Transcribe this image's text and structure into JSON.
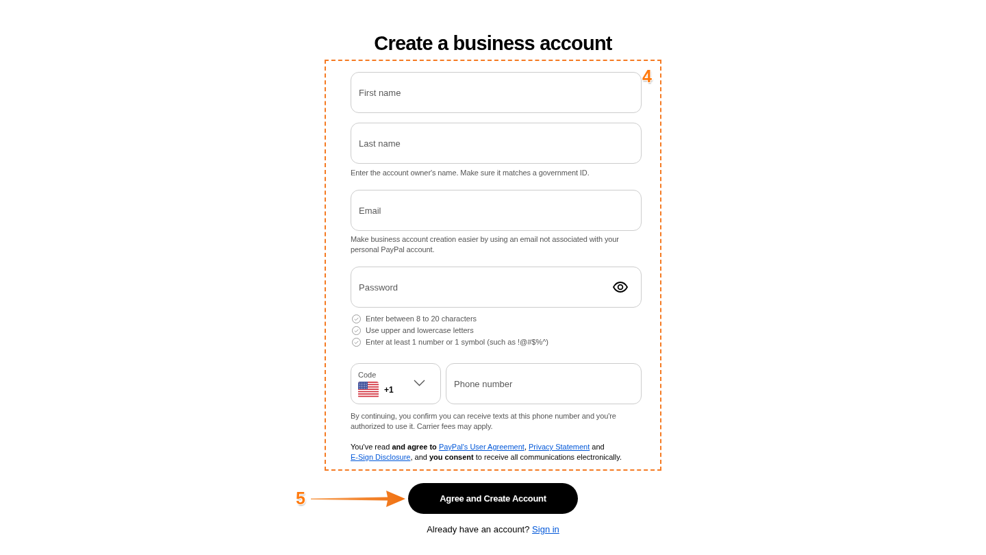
{
  "title": "Create a business account",
  "form": {
    "step_label": "4",
    "fields": [
      {
        "kind": "text",
        "placeholder": "First name"
      },
      {
        "kind": "text",
        "placeholder": "Last name",
        "hint": "Enter the account owner's name. Make sure it matches a government ID."
      },
      {
        "kind": "text",
        "placeholder": "Email",
        "hint": "Make business account creation easier by using an email not associated with your personal PayPal account."
      },
      {
        "kind": "password",
        "placeholder": "Password",
        "requirements": [
          {
            "text": "Enter between 8 to 20 characters",
            "met": false
          },
          {
            "text": "Use upper and lowercase letters",
            "met": false
          },
          {
            "text": "Enter at least 1 number or 1 symbol (such as !@#$%^)",
            "met": false
          }
        ]
      },
      {
        "kind": "phone",
        "code": {
          "label": "Code",
          "value": "+1"
        },
        "placeholder": "Phone number",
        "hint": "By continuing, you confirm you can receive texts at this phone number and you're authorized to use it. Carrier fees may apply."
      }
    ],
    "agreement": [
      {
        "kind": "text",
        "text": "You've read **and agree to** "
      },
      {
        "kind": "link",
        "text": "PayPal's User Agreement"
      },
      {
        "kind": "text",
        "text": ", "
      },
      {
        "kind": "link",
        "text": "Privacy Statement"
      },
      {
        "kind": "text",
        "text": " and "
      },
      {
        "kind": "link",
        "text": "E-Sign Disclosure"
      },
      {
        "kind": "text",
        "text": ", and **you consent** to receive all communications electronically."
      }
    ]
  },
  "submit": {
    "label": "Agree and Create Account",
    "step_label": "5"
  },
  "signin": {
    "prompt": "Already have an account?",
    "link": "Sign in"
  }
}
